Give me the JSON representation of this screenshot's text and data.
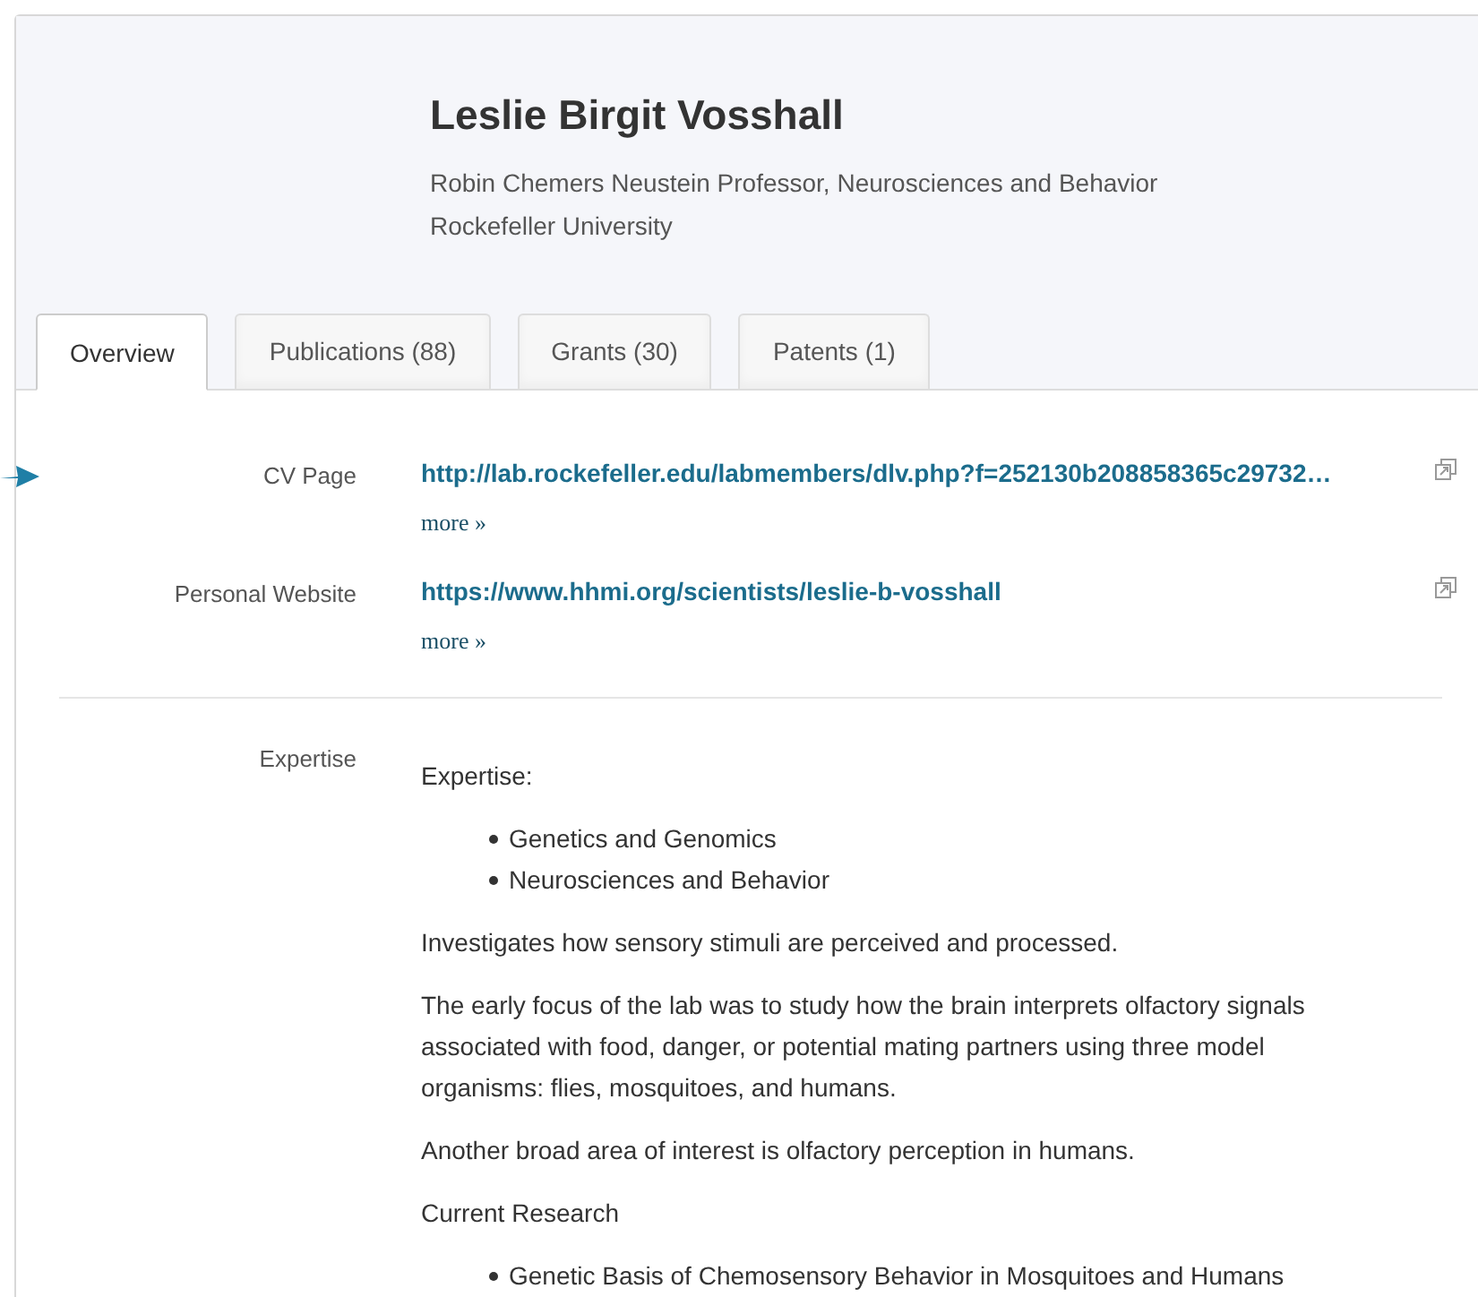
{
  "profile": {
    "name": "Leslie Birgit Vosshall",
    "title": "Robin Chemers Neustein Professor, Neurosciences and Behavior",
    "institution": "Rockefeller University"
  },
  "tabs": [
    {
      "label": "Overview",
      "selected": true
    },
    {
      "label": "Publications (88)",
      "selected": false
    },
    {
      "label": "Grants (30)",
      "selected": false
    },
    {
      "label": "Patents (1)",
      "selected": false
    }
  ],
  "links": [
    {
      "label": "CV Page",
      "url": "http://lab.rockefeller.edu/labmembers/dlv.php?f=252130b208858365c29732…",
      "more": "more »"
    },
    {
      "label": "Personal Website",
      "url": "https://www.hhmi.org/scientists/leslie-b-vosshall",
      "more": "more »"
    }
  ],
  "expertise": {
    "label": "Expertise",
    "blocks": [
      {
        "kind": "paragraph",
        "text": "Expertise:"
      },
      {
        "kind": "list",
        "items": [
          "Genetics and Genomics",
          "Neurosciences and Behavior"
        ]
      },
      {
        "kind": "paragraph",
        "text": "Investigates how sensory stimuli are perceived and processed."
      },
      {
        "kind": "paragraph",
        "text": "The early focus of the lab was to study how the brain interprets olfactory signals associated with food, danger, or potential mating partners using three model organisms: flies, mosquitoes, and humans."
      },
      {
        "kind": "paragraph",
        "text": "Another broad area of interest is olfactory perception in humans."
      },
      {
        "kind": "paragraph",
        "text": "Current Research"
      },
      {
        "kind": "list",
        "items": [
          "Genetic Basis of Chemosensory Behavior in Mosquitoes and Humans"
        ]
      }
    ]
  }
}
